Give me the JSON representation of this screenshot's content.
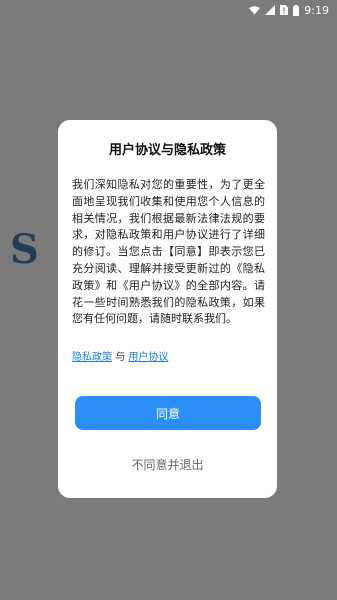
{
  "status_bar": {
    "time": "9:19",
    "icons": [
      "wifi-icon",
      "signal-icon",
      "sim-alert-icon",
      "battery-icon"
    ]
  },
  "background": {
    "logo_fragment": "S"
  },
  "dialog": {
    "title": "用户协议与隐私政策",
    "body": "我们深知隐私对您的重要性，为了更全面地呈现我们收集和使用您个人信息的相关情况，我们根据最新法律法规的要求，对隐私政策和用户协议进行了详细的修订。当您点击【同意】即表示您已充分阅读、理解并接受更新过的《隐私政策》和《用户协议》的全部内容。请花一些时间熟悉我们的隐私政策，如果您有任何问题，请随时联系我们。",
    "privacy_link": "隐私政策",
    "link_separator": "与",
    "user_agreement_link": "用户协议",
    "agree_label": "同意",
    "disagree_label": "不同意并退出"
  },
  "colors": {
    "overlay": "#7b7b7b",
    "accent": "#2b8ef5",
    "link": "#1b7fe6"
  }
}
